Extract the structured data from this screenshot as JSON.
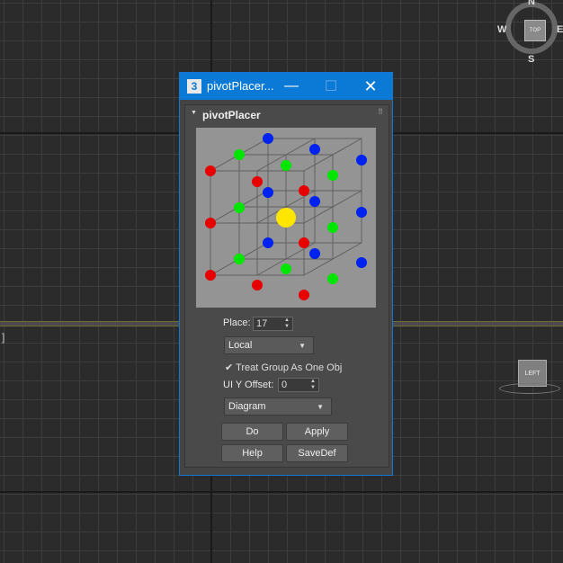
{
  "viewport": {
    "left_bracket": "]",
    "compass": {
      "north": "N",
      "south": "S",
      "east": "E",
      "west": "W",
      "top_label": "TOP"
    },
    "left_cube_label": "LEFT"
  },
  "window": {
    "title": "pivotPlacer...",
    "icon_glyph": "3",
    "minimize_glyph": "—",
    "maximize_glyph": "☐",
    "close_glyph": "✕"
  },
  "rollout": {
    "title": "pivotPlacer",
    "arrow": "▼",
    "grip": "⠿"
  },
  "controls": {
    "place_label": "Place:",
    "place_value": "17",
    "space_dropdown": "Local",
    "treat_group_checked": true,
    "treat_group_label": "Treat Group As One Obj",
    "ui_offset_label": "UI Y Offset:",
    "ui_offset_value": "0",
    "mode_dropdown": "Diagram",
    "do_button": "Do",
    "apply_button": "Apply",
    "help_button": "Help",
    "savedef_button": "SaveDef"
  },
  "colors": {
    "title_bar": "#0b7ad6",
    "corner": "#ff0000",
    "edge": "#00ff00",
    "face": "#0000ff",
    "selected": "#ffe600"
  }
}
